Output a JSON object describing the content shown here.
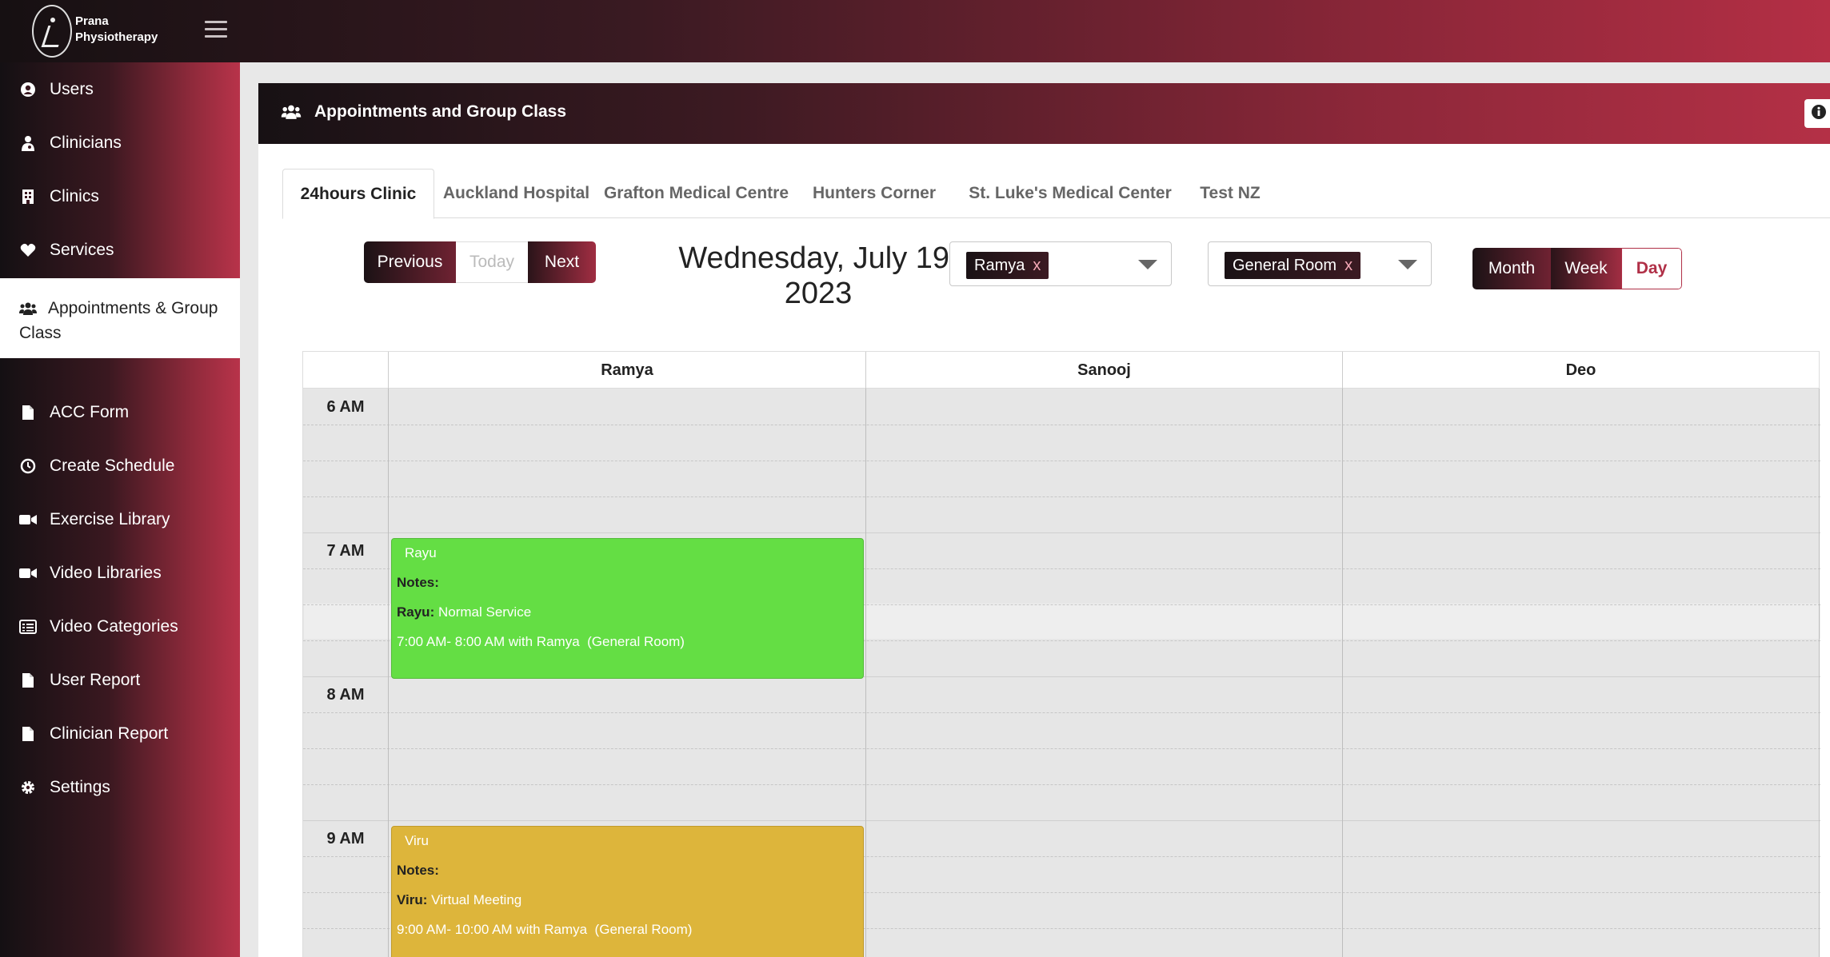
{
  "brand": {
    "line1": "Prana",
    "line2": "Physiotherapy"
  },
  "sidebar": {
    "items": [
      {
        "label": "Users",
        "icon": "user-circle-icon"
      },
      {
        "label": "Clinicians",
        "icon": "user-doctor-icon"
      },
      {
        "label": "Clinics",
        "icon": "building-icon"
      },
      {
        "label": "Services",
        "icon": "heart-icon"
      },
      {
        "label": "Appointments & Group Class",
        "icon": "users-icon",
        "active": true
      },
      {
        "label": "ACC Form",
        "icon": "file-icon"
      },
      {
        "label": "Create Schedule",
        "icon": "clock-icon"
      },
      {
        "label": "Exercise Library",
        "icon": "video-icon"
      },
      {
        "label": "Video Libraries",
        "icon": "video-icon"
      },
      {
        "label": "Video Categories",
        "icon": "list-icon"
      },
      {
        "label": "User Report",
        "icon": "file-icon"
      },
      {
        "label": "Clinician Report",
        "icon": "file-icon"
      },
      {
        "label": "Settings",
        "icon": "gear-icon"
      }
    ]
  },
  "header": {
    "title": "Appointments and Group Class"
  },
  "tabs": [
    "24hours Clinic",
    "Auckland Hospital",
    "Grafton Medical Centre",
    "Hunters Corner",
    "St. Luke's Medical Center",
    "Test NZ"
  ],
  "toolbar": {
    "previous": "Previous",
    "today": "Today",
    "next": "Next",
    "month": "Month",
    "week": "Week",
    "day": "Day"
  },
  "date_title": "Wednesday, July 19, 2023",
  "filters": {
    "clinician": {
      "value": "Ramya",
      "remove": "x"
    },
    "room": {
      "value": "General Room",
      "remove": "x"
    }
  },
  "calendar": {
    "columns": [
      "Ramya",
      "Sanooj",
      "Deo"
    ],
    "times": [
      "6 AM",
      "7 AM",
      "8 AM",
      "9 AM"
    ],
    "events": [
      {
        "title": "Rayu",
        "notes_label": "Notes:",
        "service_label": "Rayu:",
        "service": "Normal Service",
        "time": "7:00 AM- 8:00 AM with Ramya  (General Room)",
        "color": "#64de44"
      },
      {
        "title": "Viru",
        "notes_label": "Notes:",
        "service_label": "Viru:",
        "service": "Virtual Meeting",
        "time": "9:00 AM- 10:00 AM with Ramya  (General Room)",
        "color": "#ddb53b"
      }
    ]
  },
  "colors": {
    "brand_dark": "#171114",
    "brand_accent": "#b43046"
  }
}
